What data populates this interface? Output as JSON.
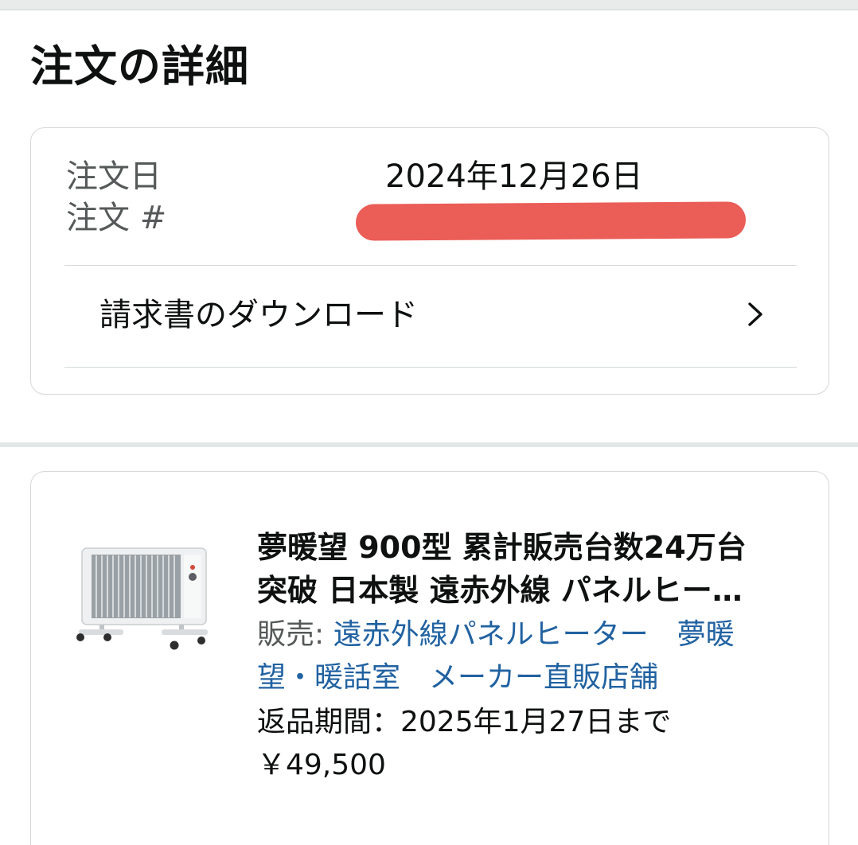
{
  "page": {
    "title": "注文の詳細"
  },
  "summary": {
    "order_date_label": "注文日",
    "order_date_value": "2024年12月26日",
    "order_number_label": "注文 #",
    "order_number_value": "",
    "invoice_link_label": "請求書のダウンロード",
    "invoice_icon": "chevron-right-icon"
  },
  "item": {
    "title_line1": "夢暖望 900型 累計販売台数24万台",
    "title_line2": "突破 日本製 遠赤外線 パネルヒー…",
    "seller_prefix": "販売: ",
    "seller_name_line1": "遠赤外線パネルヒーター　夢暖",
    "seller_name_line2": "望・暖話室　メーカー直販店舗",
    "return_window": "返品期間：2025年1月27日まで",
    "price": "￥49,500",
    "image_icon": "panel-heater-image"
  },
  "colors": {
    "text": "#0f1111",
    "muted_text": "#565959",
    "link": "#2162a1",
    "border": "#d5d9d9",
    "redaction": "#eb5d57"
  }
}
